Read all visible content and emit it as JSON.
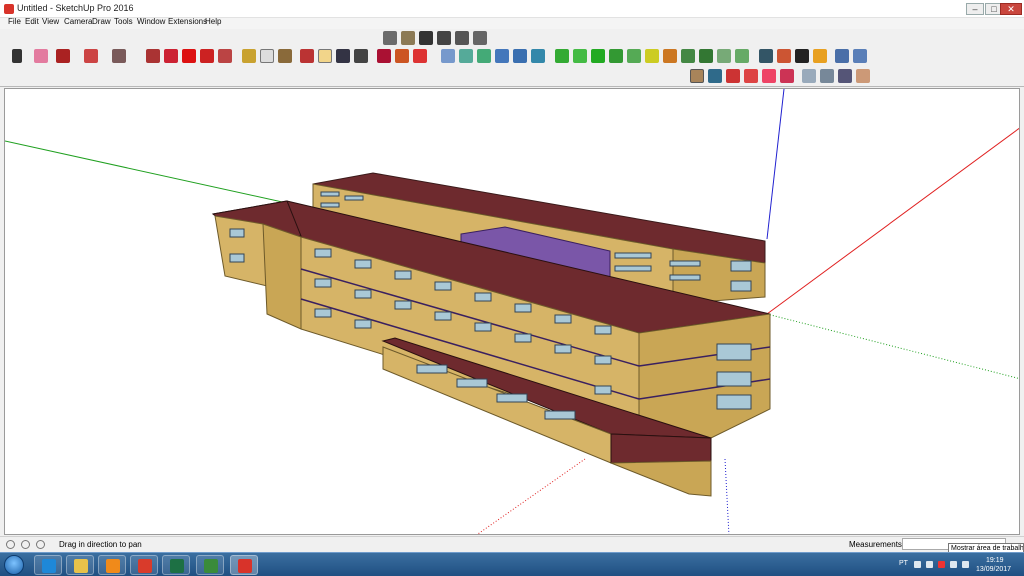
{
  "window": {
    "title": "Untitled - SketchUp Pro 2016",
    "min": "–",
    "max": "□",
    "close": "✕"
  },
  "menu": [
    "File",
    "Edit",
    "View",
    "Camera",
    "Draw",
    "Tools",
    "Window",
    "Extensions",
    "Help"
  ],
  "status": {
    "hint": "Drag in direction to pan",
    "measurements_label": "Measurements",
    "measurements_value": ""
  },
  "tooltip": "Mostrar área de trabalho",
  "taskbar": {
    "lang": "PT",
    "time": "19:19",
    "date": "13/09/2017",
    "apps": [
      {
        "name": "internet-explorer-icon",
        "color": "#1e88d8"
      },
      {
        "name": "file-explorer-icon",
        "color": "#e8c24a"
      },
      {
        "name": "media-player-icon",
        "color": "#f08a1a"
      },
      {
        "name": "chrome-icon",
        "color": "#d93b2b"
      },
      {
        "name": "excel-icon",
        "color": "#1d7044"
      },
      {
        "name": "remote-desktop-icon",
        "color": "#3a8b3a"
      },
      {
        "name": "sketchup-icon",
        "color": "#d8332a"
      }
    ]
  },
  "colors": {
    "roof": "#6e2a2e",
    "wall": "#d6b467",
    "wall_dark": "#b89547",
    "window": "#a9c8d6",
    "highlight": "#7a56a8",
    "axis_red": "#e02020",
    "axis_green": "#20a020",
    "axis_blue": "#2020d0"
  }
}
